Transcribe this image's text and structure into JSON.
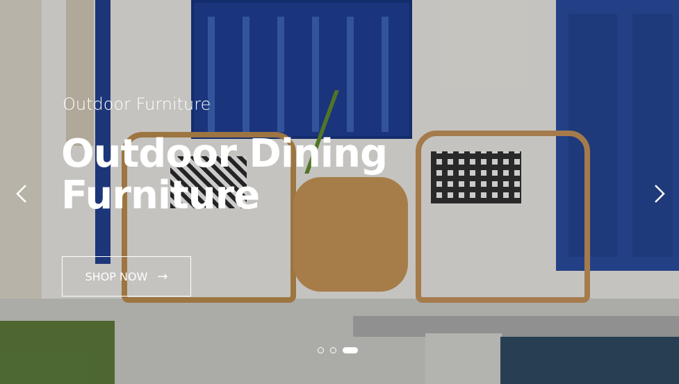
{
  "slider": {
    "subtitle": "Outdoor Furniture",
    "title": "Outdoor Dining Furniture",
    "button_label": "SHOP NOW",
    "button_arrow": "→",
    "prev_icon": "chevron-left-icon",
    "next_icon": "chevron-right-icon",
    "dots": [
      {
        "active": false
      },
      {
        "active": false
      },
      {
        "active": true
      }
    ]
  },
  "colors": {
    "text": "#ffffff",
    "accent_blue": "#23408f"
  }
}
